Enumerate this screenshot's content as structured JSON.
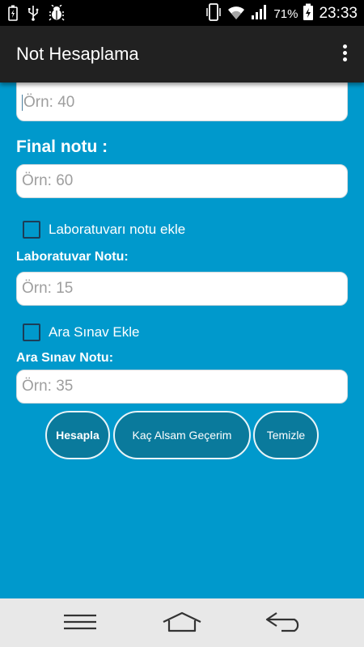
{
  "status_bar": {
    "battery_percent": "71%",
    "time": "23:33",
    "icons": [
      "battery-charging-icon",
      "usb-icon",
      "bug-icon",
      "vibrate-icon",
      "wifi-icon",
      "signal-icon",
      "battery-icon"
    ]
  },
  "app_bar": {
    "title": "Not Hesaplama",
    "menu_icon": "overflow-menu-icon"
  },
  "form": {
    "midterm_field": {
      "placeholder": "Örn: 40",
      "value": ""
    },
    "final_label": "Final notu :",
    "final_field": {
      "placeholder": "Örn: 60",
      "value": ""
    },
    "lab_checkbox": {
      "label": "Laboratuvarı notu ekle",
      "checked": false
    },
    "lab_label": "Laboratuvar Notu:",
    "lab_field": {
      "placeholder": "Örn: 15",
      "value": ""
    },
    "quiz_checkbox": {
      "label": "Ara Sınav Ekle",
      "checked": false
    },
    "quiz_label": "Ara Sınav Notu:",
    "quiz_field": {
      "placeholder": "Örn: 35",
      "value": ""
    }
  },
  "buttons": {
    "calculate": "Hesapla",
    "how_much": "Kaç Alsam Geçerim",
    "clear": "Temizle"
  },
  "nav_bar": {
    "icons": [
      "menu-icon",
      "home-icon",
      "back-icon"
    ]
  },
  "colors": {
    "background": "#0099cc",
    "app_bar": "#212121",
    "button_fill": "#0a7a9c",
    "nav_bar": "#e8e8e8"
  }
}
